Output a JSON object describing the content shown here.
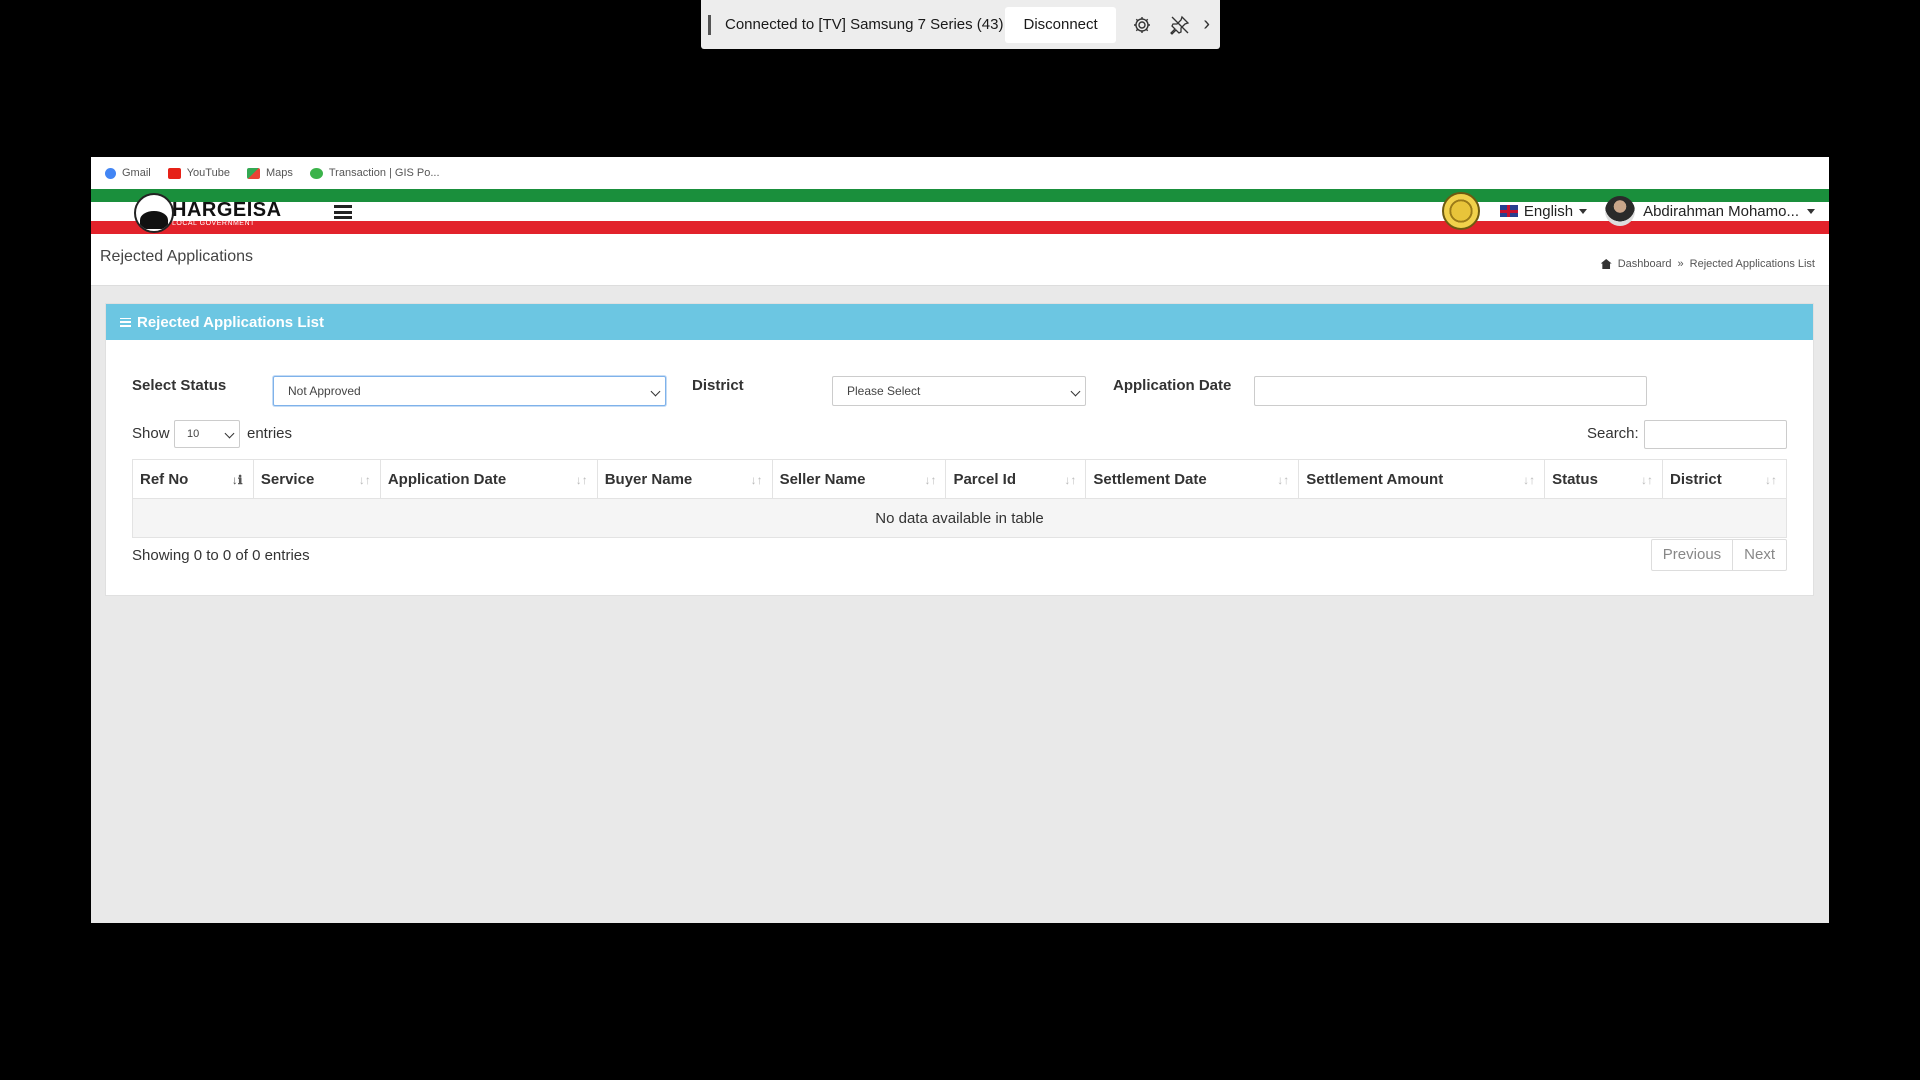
{
  "cast_bar": {
    "status_text": "Connected to [TV] Samsung 7 Series (43)",
    "disconnect_label": "Disconnect",
    "more_glyph": "›"
  },
  "bookmarks": [
    {
      "label": "Gmail",
      "icon": "google-icon",
      "color": "#4285f4"
    },
    {
      "label": "YouTube",
      "icon": "youtube-icon",
      "color": "#e62117"
    },
    {
      "label": "Maps",
      "icon": "maps-icon",
      "color": "#34a853"
    },
    {
      "label": "Transaction | GIS Po...",
      "icon": "gis-icon",
      "color": "#3bb34a"
    }
  ],
  "brand": {
    "name": "HARGEISA",
    "subtitle": "LOCAL GOVERNMENT",
    "colors": {
      "green": "#1a8f3c",
      "red": "#e2222b",
      "accent": "#6cc6e2"
    }
  },
  "header": {
    "language": "English",
    "user_name": "Abdirahman Mohamo..."
  },
  "page": {
    "title": "Rejected Applications",
    "breadcrumb": [
      "Dashboard",
      "»",
      "Rejected Applications List"
    ]
  },
  "card": {
    "title": "Rejected Applications List"
  },
  "filters": {
    "status_label": "Select Status",
    "status_value": "Not Approved",
    "district_label": "District",
    "district_value": "Please Select",
    "date_label": "Application Date",
    "date_value": ""
  },
  "table_controls": {
    "show_label": "Show",
    "entries_value": "10",
    "entries_label": "entries",
    "search_label": "Search:"
  },
  "table": {
    "columns": [
      "Ref No",
      "Service",
      "Application Date",
      "Buyer Name",
      "Seller Name",
      "Parcel Id",
      "Settlement Date",
      "Settlement Amount",
      "Status",
      "District"
    ],
    "sorted_column": "Ref No",
    "empty_text": "No data available in table"
  },
  "footer": {
    "info": "Showing 0 to 0 of 0 entries",
    "prev_label": "Previous",
    "next_label": "Next"
  }
}
